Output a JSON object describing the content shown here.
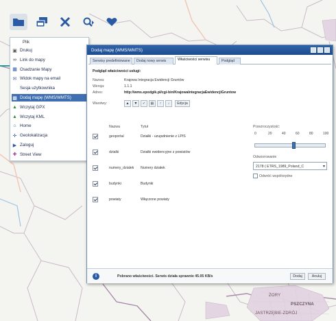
{
  "map": {
    "labels": [
      "PSZCZYNA",
      "ŻORY",
      "JASTRZĘBIE-ZDRÓJ"
    ]
  },
  "toolbar": {
    "buttons": [
      {
        "icon": "file-icon"
      },
      {
        "icon": "windows-icon"
      },
      {
        "icon": "tools-icon"
      },
      {
        "icon": "search-icon"
      },
      {
        "icon": "favorite-icon"
      }
    ]
  },
  "menu": {
    "header": "Plik",
    "items": [
      {
        "label": "Drukuj",
        "icon": "printer-icon"
      },
      {
        "label": "Link do mapy",
        "icon": "link-icon"
      },
      {
        "label": "Osadzanie Mapy",
        "icon": "embed-icon"
      },
      {
        "label": "Widok mapy na email",
        "icon": "email-icon"
      },
      {
        "label": "Sesja użytkownika",
        "icon": ""
      },
      {
        "label": "Dodaj mapę (WMS/WMTS)",
        "icon": "add-map-icon",
        "selected": true
      },
      {
        "label": "Wczytaj GPX",
        "icon": "gpx-icon"
      },
      {
        "label": "Wczytaj KML",
        "icon": "kml-icon"
      },
      {
        "label": "Home",
        "icon": "home-icon"
      },
      {
        "label": "Geolokalizacja",
        "icon": "geolocation-icon"
      },
      {
        "label": "Zaloguj",
        "icon": "login-icon"
      },
      {
        "label": "Street View",
        "icon": "street-view-icon"
      }
    ]
  },
  "dialog": {
    "title": "Dodaj mapę (WMS/WMTS)",
    "tabs": [
      "Serwisy predefiniowane",
      "Dodaj nowy serwis",
      "Właściwości serwisu",
      "Podgląd"
    ],
    "active_tab": 2,
    "section_title": "Podgląd właściwości usługi:",
    "props": {
      "name_label": "Nazwa:",
      "name_value": "Krajowa Integracja Ewidencji Gruntów",
      "version_label": "Wersja:",
      "version_value": "1.1.1",
      "address_label": "Adres:",
      "address_value": "http://wms.epodgik.pl/cgi-bin/KrajowaIntegracjaEwidencjiGruntow",
      "layers_label": "Warstwy:",
      "edit_button": "Edycja"
    },
    "table": {
      "col_name": "Nazwa",
      "col_title": "Tytuł",
      "rows": [
        {
          "name": "geoportal",
          "title": "Działki - uzupełnienie z LPIS",
          "checked": true
        },
        {
          "name": "dzialki",
          "title": "Działki ewidencyjne z powiatów",
          "checked": true
        },
        {
          "name": "numery_dzialek",
          "title": "Numery działek",
          "checked": true
        },
        {
          "name": "budynki",
          "title": "Budynki",
          "checked": true
        },
        {
          "name": "powiaty",
          "title": "Włączone powiaty",
          "checked": true
        }
      ]
    },
    "opacity": {
      "label": "Przezroczystość:",
      "ticks": [
        "0",
        "20",
        "40",
        "60",
        "80",
        "100"
      ],
      "value_percent": 55
    },
    "projection": {
      "label": "Odwzorowanie",
      "selected": "2178 ( ETRS_1989_Poland_C",
      "swap_label": "Odwróć współrzędne"
    },
    "footer": {
      "status": "Pobrano właściwości. Serwis działa sprawnie 45.05 KB/s",
      "add_button": "Dodaj",
      "cancel_button": "Anuluj"
    }
  }
}
